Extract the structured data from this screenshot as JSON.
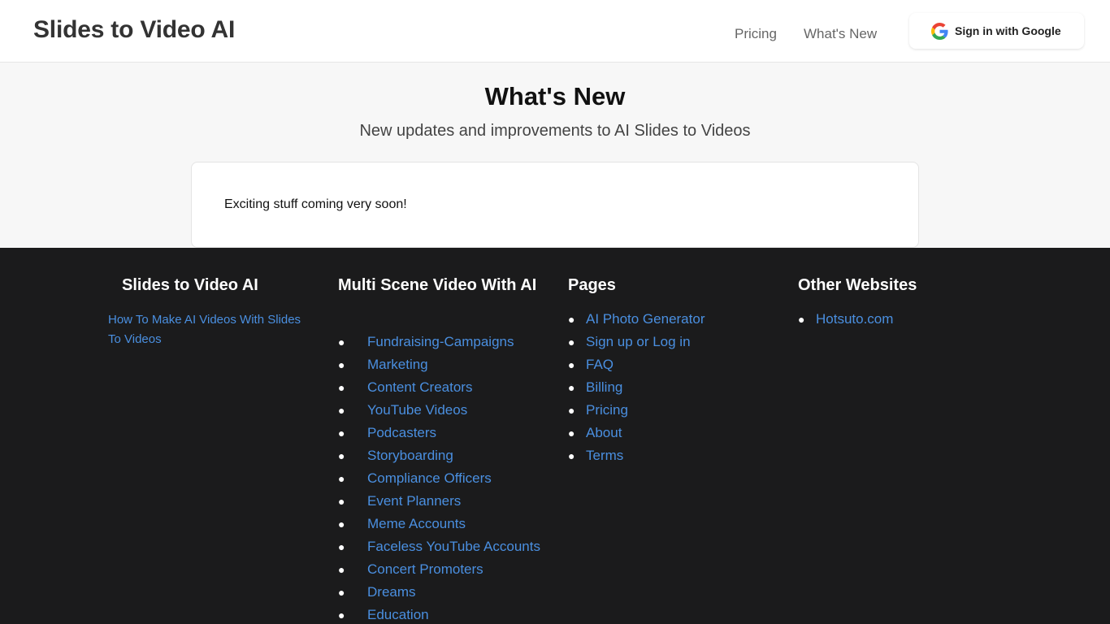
{
  "header": {
    "brand": "Slides to Video AI",
    "nav": {
      "pricing": "Pricing",
      "whats_new": "What's New"
    },
    "sign_in_label": "Sign in with Google",
    "sign_in_icon": "google-g-icon"
  },
  "main": {
    "title": "What's New",
    "subtitle": "New updates and improvements to AI Slides to Videos",
    "card_text": "Exciting stuff coming very soon!"
  },
  "footer": {
    "col1": {
      "title": "Slides to Video AI",
      "link": "How To Make AI Videos With Slides To Videos"
    },
    "col2": {
      "title": "Multi Scene Video With AI",
      "items": [
        "Fundraising-Campaigns",
        "Marketing",
        "Content Creators",
        "YouTube Videos",
        "Podcasters",
        "Storyboarding",
        "Compliance Officers",
        "Event Planners",
        "Meme Accounts",
        "Faceless YouTube Accounts",
        "Concert Promoters",
        "Dreams",
        "Education"
      ]
    },
    "col3": {
      "title": "Pages",
      "items": [
        "AI Photo Generator",
        "Sign up or Log in",
        "FAQ",
        "Billing",
        "Pricing",
        "About",
        "Terms"
      ]
    },
    "col4": {
      "title": "Other Websites",
      "items": [
        "Hotsuto.com"
      ]
    }
  },
  "colors": {
    "link": "#4a8fe0",
    "footer_bg": "#1b1b1c",
    "page_bg": "#f7f7f7"
  }
}
